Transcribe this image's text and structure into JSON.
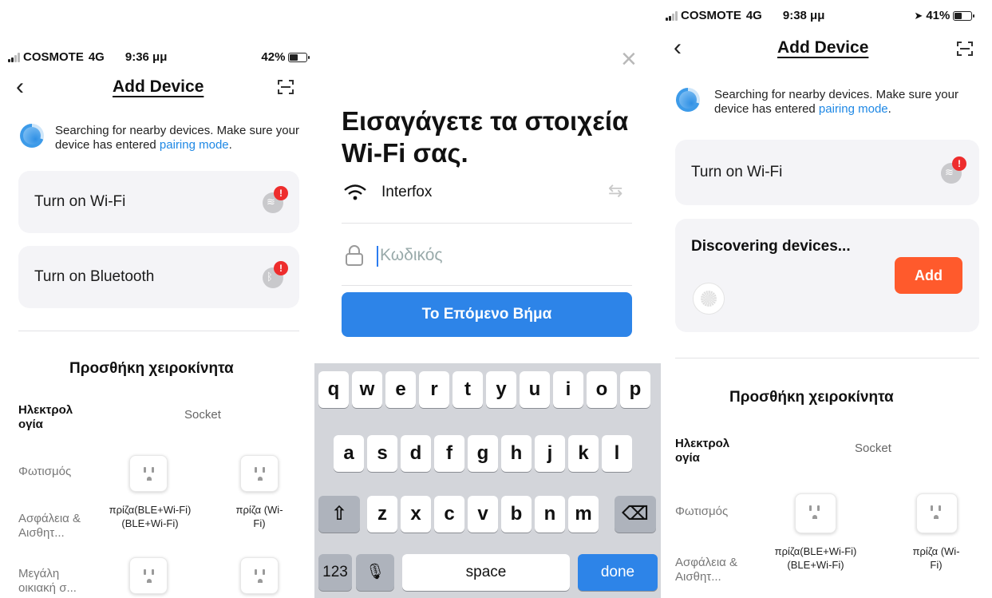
{
  "screen1": {
    "status": {
      "carrier": "COSMOTE",
      "network": "4G",
      "time": "9:36 μμ",
      "battery": "42%",
      "battery_fraction": 0.42
    },
    "title": "Add Device",
    "search_text": "Searching for nearby devices. Make sure your device has entered ",
    "search_link": "pairing mode",
    "search_end": ".",
    "cards": [
      {
        "label": "Turn on Wi-Fi",
        "icon": "wifi-icon"
      },
      {
        "label": "Turn on Bluetooth",
        "icon": "bluetooth-icon"
      }
    ],
    "badge": "!",
    "manual_title": "Προσθήκη χειροκίνητα",
    "categories": [
      "Ηλεκτρολ ογία",
      "Φωτισμός",
      "Ασφάλεια & Αισθητ...",
      "Μεγάλη οικιακή σ..."
    ],
    "socket_header": "Socket",
    "devices": [
      {
        "label": "πρίζα(BLE+Wi-Fi) (BLE+Wi-Fi)"
      },
      {
        "label": "πρίζα (Wi-Fi)"
      }
    ]
  },
  "screen2": {
    "close": "×",
    "title": "Εισαγάγετε τα στοιχεία Wi-Fi σας.",
    "ssid": "Interfox",
    "password_placeholder": "Κωδικός",
    "next_button": "Το Επόμενο Βήμα",
    "keyboard": {
      "row1": [
        "q",
        "w",
        "e",
        "r",
        "t",
        "y",
        "u",
        "i",
        "o",
        "p"
      ],
      "row2": [
        "a",
        "s",
        "d",
        "f",
        "g",
        "h",
        "j",
        "k",
        "l"
      ],
      "row3": [
        "z",
        "x",
        "c",
        "v",
        "b",
        "n",
        "m"
      ],
      "shift": "⇧",
      "backspace": "⌫",
      "numbers": "123",
      "mic": "🎙",
      "space": "space",
      "done": "done"
    }
  },
  "screen3": {
    "status": {
      "carrier": "COSMOTE",
      "network": "4G",
      "time": "9:38 μμ",
      "battery": "41%",
      "battery_fraction": 0.41
    },
    "title": "Add Device",
    "search_text": "Searching for nearby devices. Make sure your device has entered ",
    "search_link": "pairing mode",
    "search_end": ".",
    "wifi_card": "Turn on Wi-Fi",
    "discover_title": "Discovering devices...",
    "add_button": "Add",
    "badge": "!",
    "manual_title": "Προσθήκη χειροκίνητα",
    "categories": [
      "Ηλεκτρολ ογία",
      "Φωτισμός",
      "Ασφάλεια & Αισθητ..."
    ],
    "socket_header": "Socket",
    "devices": [
      {
        "label": "πρίζα(BLE+Wi-Fi) (BLE+Wi-Fi)"
      },
      {
        "label": "πρίζα (Wi-Fi)"
      }
    ]
  }
}
